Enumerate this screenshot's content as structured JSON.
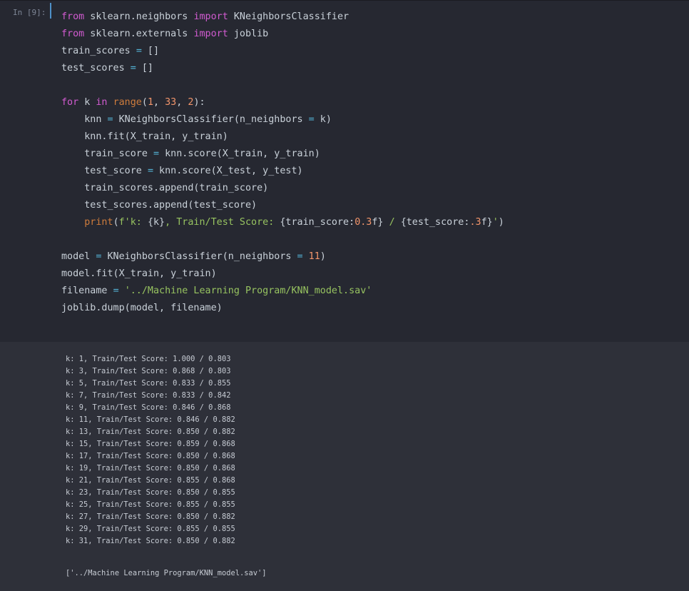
{
  "cell": {
    "prompt": "In [9]:",
    "code_lines": [
      [
        [
          "kw",
          "from"
        ],
        [
          "t",
          " sklearn.neighbors "
        ],
        [
          "kw",
          "import"
        ],
        [
          "t",
          " KNeighborsClassifier"
        ]
      ],
      [
        [
          "kw",
          "from"
        ],
        [
          "t",
          " sklearn.externals "
        ],
        [
          "kw",
          "import"
        ],
        [
          "t",
          " joblib"
        ]
      ],
      [
        [
          "t",
          "train_scores "
        ],
        [
          "op",
          "="
        ],
        [
          "t",
          " []"
        ]
      ],
      [
        [
          "t",
          "test_scores "
        ],
        [
          "op",
          "="
        ],
        [
          "t",
          " []"
        ]
      ],
      [],
      [
        [
          "kw",
          "for"
        ],
        [
          "t",
          " k "
        ],
        [
          "kw",
          "in"
        ],
        [
          "t",
          " "
        ],
        [
          "fn",
          "range"
        ],
        [
          "t",
          "("
        ],
        [
          "num",
          "1"
        ],
        [
          "t",
          ", "
        ],
        [
          "num",
          "33"
        ],
        [
          "t",
          ", "
        ],
        [
          "num",
          "2"
        ],
        [
          "t",
          "):"
        ]
      ],
      [
        [
          "t",
          "    knn "
        ],
        [
          "op",
          "="
        ],
        [
          "t",
          " KNeighborsClassifier(n_neighbors "
        ],
        [
          "op",
          "="
        ],
        [
          "t",
          " k)"
        ]
      ],
      [
        [
          "t",
          "    knn.fit(X_train, y_train)"
        ]
      ],
      [
        [
          "t",
          "    train_score "
        ],
        [
          "op",
          "="
        ],
        [
          "t",
          " knn.score(X_train, y_train)"
        ]
      ],
      [
        [
          "t",
          "    test_score "
        ],
        [
          "op",
          "="
        ],
        [
          "t",
          " knn.score(X_test, y_test)"
        ]
      ],
      [
        [
          "t",
          "    train_scores.append(train_score)"
        ]
      ],
      [
        [
          "t",
          "    test_scores.append(test_score)"
        ]
      ],
      [
        [
          "t",
          "    "
        ],
        [
          "fn",
          "print"
        ],
        [
          "t",
          "("
        ],
        [
          "str",
          "f'k: "
        ],
        [
          "t",
          "{k}"
        ],
        [
          "str",
          ", Train/Test Score: "
        ],
        [
          "t",
          "{train_score:"
        ],
        [
          "num",
          "0.3"
        ],
        [
          "t",
          "f} "
        ],
        [
          "str",
          "/ "
        ],
        [
          "t",
          "{test_score:"
        ],
        [
          "num",
          ".3"
        ],
        [
          "t",
          "f}"
        ],
        [
          "str",
          "'"
        ],
        [
          "t",
          ")"
        ]
      ],
      [],
      [
        [
          "t",
          "model "
        ],
        [
          "op",
          "="
        ],
        [
          "t",
          " KNeighborsClassifier(n_neighbors "
        ],
        [
          "op",
          "="
        ],
        [
          "t",
          " "
        ],
        [
          "num",
          "11"
        ],
        [
          "t",
          ")"
        ]
      ],
      [
        [
          "t",
          "model.fit(X_train, y_train)"
        ]
      ],
      [
        [
          "t",
          "filename "
        ],
        [
          "op",
          "="
        ],
        [
          "t",
          " "
        ],
        [
          "str",
          "'../Machine Learning Program/KNN_model.sav'"
        ]
      ],
      [
        [
          "t",
          "joblib.dump(model, filename)"
        ]
      ]
    ]
  },
  "output": {
    "stdout_lines": [
      "k: 1, Train/Test Score: 1.000 / 0.803",
      "k: 3, Train/Test Score: 0.868 / 0.803",
      "k: 5, Train/Test Score: 0.833 / 0.855",
      "k: 7, Train/Test Score: 0.833 / 0.842",
      "k: 9, Train/Test Score: 0.846 / 0.868",
      "k: 11, Train/Test Score: 0.846 / 0.882",
      "k: 13, Train/Test Score: 0.850 / 0.882",
      "k: 15, Train/Test Score: 0.859 / 0.868",
      "k: 17, Train/Test Score: 0.850 / 0.868",
      "k: 19, Train/Test Score: 0.850 / 0.868",
      "k: 21, Train/Test Score: 0.855 / 0.868",
      "k: 23, Train/Test Score: 0.850 / 0.855",
      "k: 25, Train/Test Score: 0.855 / 0.855",
      "k: 27, Train/Test Score: 0.850 / 0.882",
      "k: 29, Train/Test Score: 0.855 / 0.855",
      "k: 31, Train/Test Score: 0.850 / 0.882"
    ],
    "result": "['../Machine Learning Program/KNN_model.sav']"
  },
  "colors": {
    "keyword": "#d15bd0",
    "builtin": "#cf7c3c",
    "string": "#97c360",
    "number": "#f2956b",
    "operator": "#54b5d8",
    "code_text": "#c9d1d9",
    "input_bg": "#262831",
    "output_bg": "#2e3039",
    "active_marker": "#4e90c8"
  }
}
